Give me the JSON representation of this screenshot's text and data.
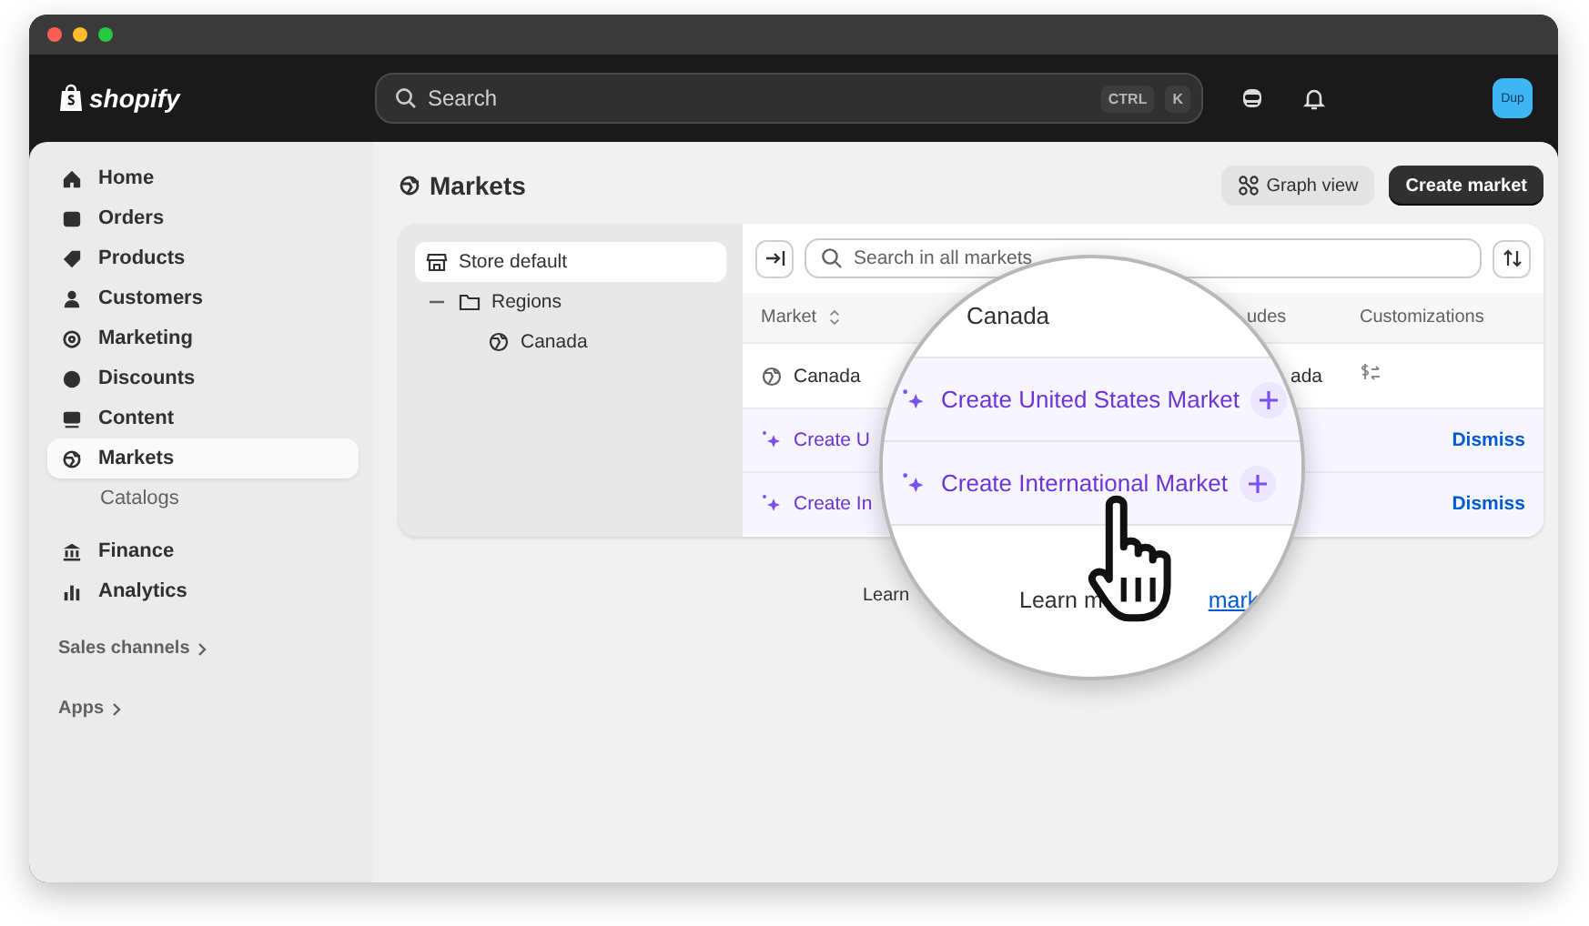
{
  "topbar": {
    "logo": "shopify",
    "search": {
      "placeholder": "Search",
      "keys": [
        "CTRL",
        "K"
      ]
    },
    "avatar": "Dup"
  },
  "sidebar": {
    "items": [
      {
        "label": "Home",
        "selected": false
      },
      {
        "label": "Orders",
        "selected": false
      },
      {
        "label": "Products",
        "selected": false
      },
      {
        "label": "Customers",
        "selected": false
      },
      {
        "label": "Marketing",
        "selected": false
      },
      {
        "label": "Discounts",
        "selected": false
      },
      {
        "label": "Content",
        "selected": false
      },
      {
        "label": "Markets",
        "selected": true,
        "children": [
          {
            "label": "Catalogs",
            "selected": false
          }
        ]
      },
      {
        "label": "Finance",
        "selected": false
      },
      {
        "label": "Analytics",
        "selected": false
      }
    ],
    "sections": [
      "Sales channels",
      "Apps"
    ]
  },
  "page": {
    "title": "Markets",
    "actions": [
      {
        "label": "Graph view",
        "kind": "secondary"
      },
      {
        "label": "Create market",
        "kind": "primary"
      }
    ]
  },
  "tree": {
    "items": [
      {
        "label": "Store default",
        "selected": true
      },
      {
        "label": "Regions",
        "selected": false,
        "expanded": true,
        "children": [
          {
            "label": "Canada",
            "selected": false
          }
        ]
      }
    ]
  },
  "table": {
    "search": {
      "placeholder": "Search in all markets"
    },
    "columns": [
      "Market",
      "udes",
      "Customizations"
    ],
    "rows": [
      {
        "kind": "market",
        "cells": [
          "Canada",
          "ada"
        ]
      },
      {
        "kind": "suggestion",
        "label": "Create U",
        "action": "Dismiss"
      },
      {
        "kind": "suggestion",
        "label": "Create In",
        "action": "Dismiss"
      }
    ]
  },
  "footer": {
    "text": "Learn"
  },
  "magnifier": {
    "heading": "Canada",
    "rows": [
      {
        "kind": "suggestion",
        "label": "Create United States Market"
      },
      {
        "kind": "suggestion",
        "label": "Create International Market"
      }
    ],
    "text": "Learn m",
    "link": "mark"
  }
}
